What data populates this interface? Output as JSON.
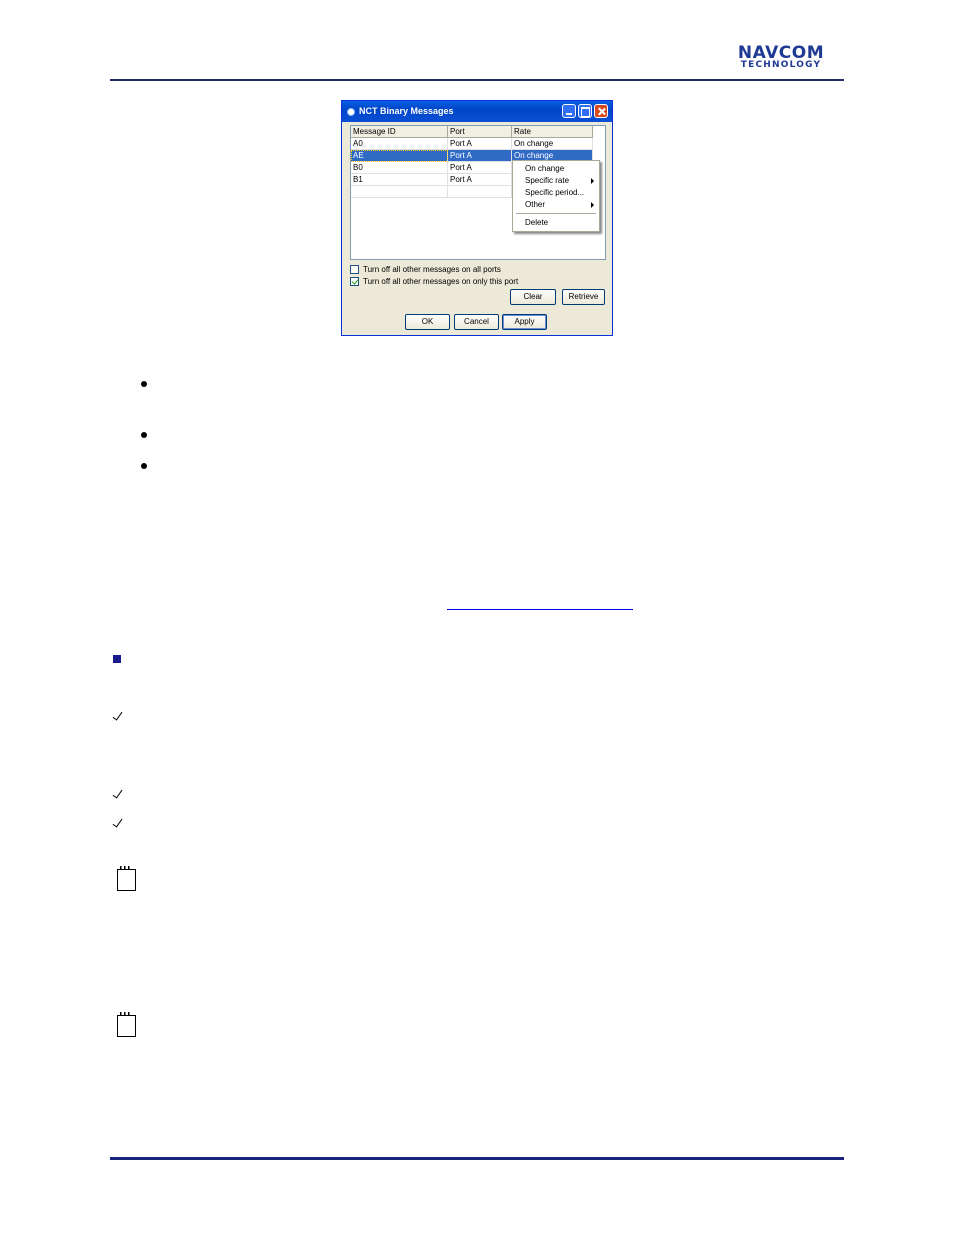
{
  "header": {
    "logo_line1": "NAVCOM",
    "logo_line2": "TECHNOLOGY",
    "brand_color": "#1f3a93"
  },
  "dialog": {
    "title": "NCT Binary Messages",
    "columns": [
      "Message ID",
      "Port",
      "Rate"
    ],
    "rows": [
      {
        "id": "A0",
        "port": "Port A",
        "rate": "On change"
      },
      {
        "id": "AE",
        "port": "Port A",
        "rate": "On change",
        "selected": true
      },
      {
        "id": "B0",
        "port": "Port A",
        "rate": ""
      },
      {
        "id": "B1",
        "port": "Port A",
        "rate": ""
      }
    ],
    "context_menu": {
      "items": [
        "On change",
        "Specific rate",
        "Specific period...",
        "Other",
        "Delete"
      ]
    },
    "checkbox_all_ports": {
      "label": "Turn off all other messages on all ports",
      "checked": false
    },
    "checkbox_this_port": {
      "label": "Turn off all other messages on only this port",
      "checked": true
    },
    "buttons": {
      "clear": "Clear",
      "retrieve": "Retrieve",
      "ok": "OK",
      "cancel": "Cancel",
      "apply": "Apply"
    },
    "selection_color": "#316ac5"
  }
}
